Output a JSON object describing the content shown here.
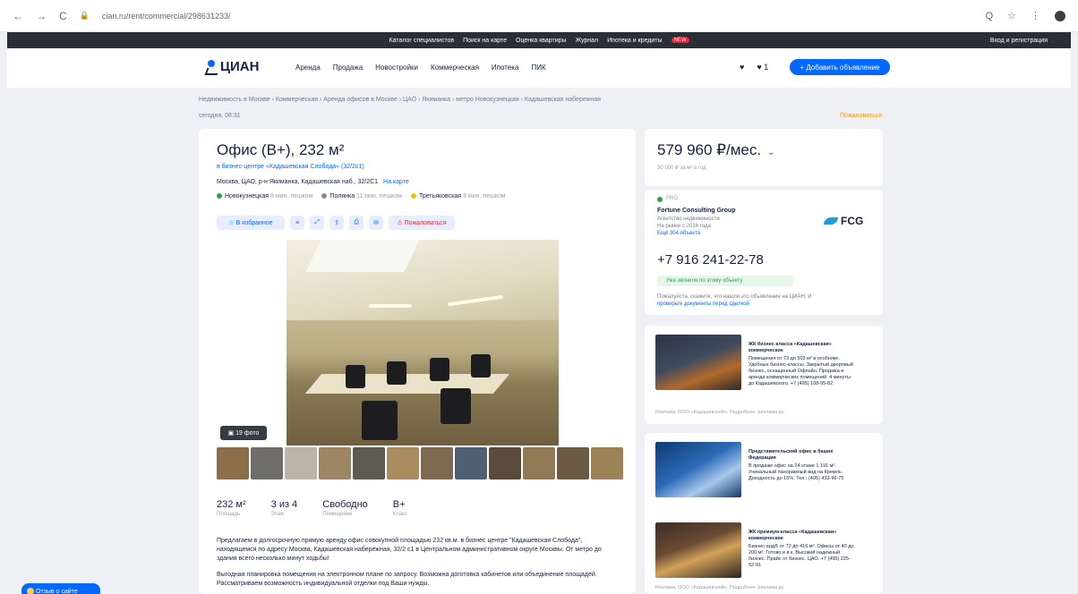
{
  "browser": {
    "nav_back": "←",
    "nav_forward": "→",
    "nav_reload": "C",
    "lock": "🔒",
    "url": "cian.ru/rent/commercial/298631233/",
    "zoom": "Q",
    "star": "☆",
    "menu": "⋮"
  },
  "topbar": {
    "links": [
      "Каталог специалистов",
      "Поиск на карте",
      "Оценка квартиры",
      "Журнал",
      "Ипотека и кредиты"
    ],
    "new_badge": "NEW",
    "login": "Вход и регистрация"
  },
  "header": {
    "logo": "ЦИАН",
    "nav": [
      "Аренда",
      "Продажа",
      "Новостройки",
      "Коммерческая",
      "Ипотека",
      "ПИК"
    ],
    "icons": [
      "♥",
      "♥ 1"
    ],
    "add_button": "+ Добавить объявление"
  },
  "breadcrumbs": "Недвижимость в Москве  ›  Коммерческая  ›  Аренда офисов в Москве  ›  ЦАО  ›  Якиманка  ›  метро Новокузнецкая  ›  Кадашевская набережная",
  "updated": "сегодня, 08:31",
  "complain": "Пожаловаться",
  "listing": {
    "title": "Офис (B+), 232 м²",
    "business_center": "в бизнес-центре «Кадашевская Слобода» (32/2с1)",
    "address": "Москва, ЦАО, р-н Якиманка, Кадашевская наб., 32/2С1",
    "map_link": "На карте",
    "metros": [
      {
        "name": "Новокузнецкая",
        "time": "8 мин. пешком",
        "color": "#2ca24c"
      },
      {
        "name": "Полянка",
        "time": "11 мин. пешком",
        "color": "#8c8c8c"
      },
      {
        "name": "Третьяковская",
        "time": "8 мин. пешком",
        "color": "#f2c300"
      }
    ],
    "actions": {
      "favorite": "☆ В избранное",
      "icons": [
        "≡",
        "⤢",
        "⇪",
        "⎙",
        "✉"
      ],
      "complaint": "⚠ Пожаловаться"
    },
    "photo_count": "▣ 19 фото",
    "facts": [
      {
        "value": "232 м²",
        "label": "Площадь"
      },
      {
        "value": "3 из 4",
        "label": "Этаж"
      },
      {
        "value": "Свободно",
        "label": "Помещение"
      },
      {
        "value": "B+",
        "label": "Класс"
      }
    ],
    "description": [
      "Предлагаем в долгосрочную прямую аренду офис совокупной площадью 232 кв.м. в бизнес центре \"Кадашевская Слобода\", находящемся по адресу Москва, Кадашевская набережная, 32/2 с1 в Центральном административном округе Москвы. От метро до здания всего несколько минут ходьбы!",
      "Выгодная планировка помещения на электронном плане по запросу. Возможна доготовка кабинетов или объединение площадей. Рассматриваем возможность индивидуальной отделки под Ваши нужды."
    ]
  },
  "price": {
    "value": "579 960 ₽/мес.",
    "chevron": "⌄",
    "per_meter": "30 000 ₽ за м² в год"
  },
  "agent": {
    "badge": "PRO",
    "name": "Fortune Consulting Group",
    "type": "Агентство недвижимости",
    "since": "На рынке с 2016 года",
    "more": "Ещё 304 объекта",
    "logo_text": "FCG",
    "phone": "+7 916 241-22-78",
    "phone_note": "Уже звонили по этому объекту",
    "footer_text": "Пожалуйста, скажите, что нашли это объявление на ЦИАН. И ",
    "footer_link": "проверьте документы перед сделкой"
  },
  "ads": [
    {
      "title": "ЖК бизнес-класса «Кадашевская» коммерческие",
      "text": "Помещения от 73 до 503 м² в особняке. Удобные бизнес-классы. Закрытый дворовый бизнес, оснащенный Офлайн. Продажа и аренда коммерческих помещений. 4 минуты до Кадашевского. +7 (495) 108-95-82",
      "footer": "Реклама. ООО «Кадашевский». Подробнее: реклама.ру"
    },
    {
      "title": "Представительский офис в башне Федерация",
      "text": "В продаже офис на 24 этаже 1 191 м². Уникальный панорамный вид на Кремль. Доходность до 15%. Тел.: (495) 432-96-75",
      "footer": ""
    },
    {
      "title": "ЖК премиум-класса «Кадашевская» коммерческие",
      "text": "Бизнес-ерд® от 72 до 416 м². Офисы от 40 до 200 м². Готово и в к. Высокий надежный бизнес. Прайс от бизнес. ЦАО. +7 (495) 225-52-91",
      "footer": "Реклама. ООО «Кадашевский». Подробнее: реклама.ру"
    }
  ],
  "feedback": "Отзыв о сайте",
  "colors": {
    "accent": "#0468ff",
    "text": "#152242",
    "background": "#eef0f3",
    "topbar": "#2a2e36"
  }
}
